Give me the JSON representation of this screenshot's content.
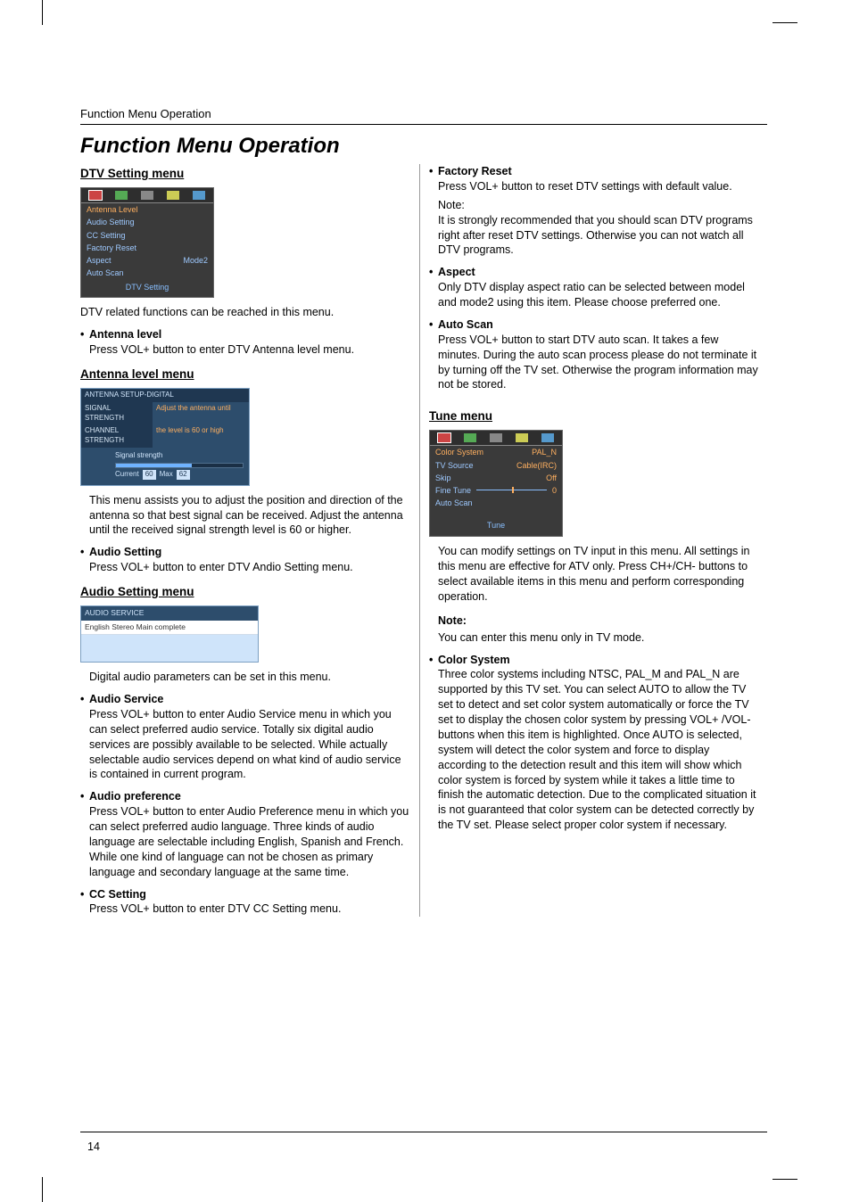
{
  "running_head": "Function Menu Operation",
  "main_title": "Function Menu Operation",
  "page_number": "14",
  "left": {
    "dtv_heading": "DTV Setting menu",
    "dtv_menu": {
      "items": [
        {
          "label": "Antenna  Level",
          "value": ""
        },
        {
          "label": "Audio  Setting",
          "value": ""
        },
        {
          "label": "CC  Setting",
          "value": ""
        },
        {
          "label": "Factory  Reset",
          "value": ""
        },
        {
          "label": "Aspect",
          "value": "Mode2"
        },
        {
          "label": "Auto  Scan",
          "value": ""
        }
      ],
      "caption": "DTV  Setting"
    },
    "dtv_intro": "DTV related functions can be reached in this menu.",
    "ant_item_title": "Antenna level",
    "ant_item_body": "Press VOL+ button to enter DTV Antenna level menu.",
    "ant_heading": "Antenna level menu",
    "ant_box": {
      "header": "ANTENNA SETUP-DIGITAL",
      "row1_label": "SIGNAL STRENGTH",
      "row1_value": "Adjust the antenna until",
      "row2_label": "CHANNEL STRENGTH",
      "row2_value": "the level is 60 or high",
      "bar_title": "Signal strength",
      "cur_label": "Current",
      "cur_val": "60",
      "max_label": "Max",
      "max_val": "62"
    },
    "ant_help": "This menu assists you to adjust the position and direction of the antenna so that best signal can be received. Adjust the antenna until the received signal strength level is 60 or higher.",
    "audio_setting_title": "Audio Setting",
    "audio_setting_body": "Press VOL+ button to enter DTV Andio Setting menu.",
    "audio_setting_heading": "Audio Setting menu",
    "audio_box": {
      "header": "AUDIO SERVICE",
      "line": "English Stereo Main complete"
    },
    "audio_help": "Digital audio parameters can be set in this menu.",
    "audio_service_title": "Audio Service",
    "audio_service_body": "Press VOL+ button to enter Audio Service menu in which you can select preferred audio service. Totally six digital audio services are possibly available to be selected. While actually selectable audio services depend on what kind of audio service is contained in current program.",
    "audio_pref_title": "Audio preference",
    "audio_pref_body": "Press VOL+ button to enter Audio Preference menu in which you can select preferred audio language. Three kinds of audio language are selectable including English, Spanish and French. While one kind of language can not be chosen as primary language and secondary language at the same time.",
    "cc_title": "CC Setting",
    "cc_body": "Press VOL+ button to enter DTV CC Setting menu."
  },
  "right": {
    "factory_title": "Factory Reset",
    "factory_body": "Press VOL+ button to reset DTV settings with default value.",
    "factory_note_label": "Note:",
    "factory_note_body": "It is strongly recommended that you should scan DTV programs right after reset DTV settings. Otherwise you can not watch all DTV programs.",
    "aspect_title": "Aspect",
    "aspect_body": "Only DTV display aspect ratio can be selected between model and mode2 using this item. Please choose preferred one.",
    "autoscan_title": "Auto Scan",
    "autoscan_body": "Press VOL+ button to start DTV auto scan. It takes a few minutes. During the auto scan process please do not terminate it by turning off the TV set. Otherwise the program information may not be stored.",
    "tune_heading": "Tune menu",
    "tune_menu": {
      "rows": [
        {
          "k": "Color  System",
          "v": "PAL_N"
        },
        {
          "k": "TV  Source",
          "v": "Cable(IRC)"
        },
        {
          "k": "Skip",
          "v": "Off"
        },
        {
          "k": "Fine  Tune",
          "v": "0",
          "slider": true
        },
        {
          "k": "Auto  Scan",
          "v": ""
        }
      ],
      "caption": "Tune"
    },
    "tune_intro1": "You can modify settings on TV input in this menu. All settings in this menu are effective for ATV only. Press CH+/CH- buttons to select available items in this menu and perform corresponding operation.",
    "tune_note_label": "Note:",
    "tune_note_body": "You can enter this menu only in TV mode.",
    "color_title": "Color System",
    "color_body": "Three color systems including NTSC, PAL_M and PAL_N are supported by this TV set. You can select AUTO to allow the TV set to detect and set color system automatically or force the TV set to display the chosen color system by pressing VOL+ /VOL- buttons when this item is highlighted. Once AUTO is selected, system will detect the color system and force to display according to the detection result and this item will show which color system is forced by system while it takes a little time to finish the automatic detection. Due to the complicated situation it is not guaranteed that color system can be detected correctly by the TV set. Please select proper color system if necessary."
  }
}
